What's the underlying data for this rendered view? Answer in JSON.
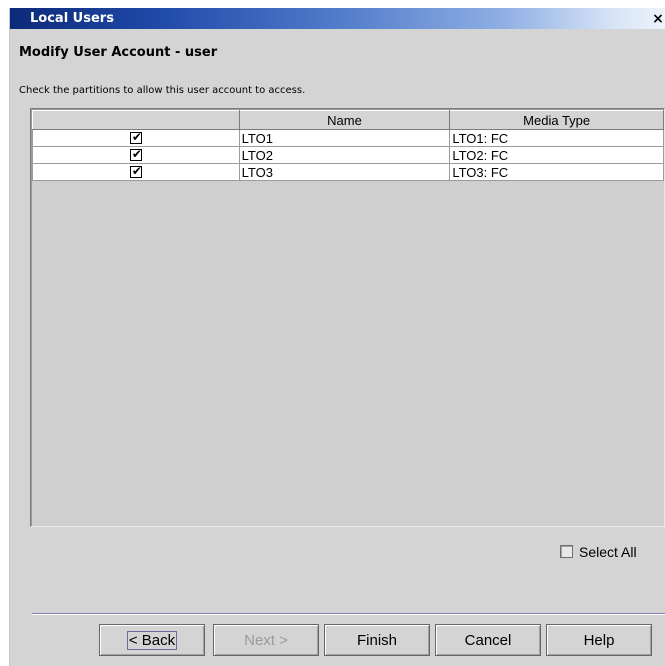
{
  "window": {
    "title": "Local Users",
    "close_glyph": "×"
  },
  "heading": "Modify User Account - user",
  "instruction": "Check the partitions to allow this user account to access.",
  "table": {
    "columns": [
      "",
      "Name",
      "Media Type"
    ],
    "rows": [
      {
        "checked": true,
        "name": "LTO1",
        "media_type": "LTO1: FC"
      },
      {
        "checked": true,
        "name": "LTO2",
        "media_type": "LTO2: FC"
      },
      {
        "checked": true,
        "name": "LTO3",
        "media_type": "LTO3: FC"
      }
    ]
  },
  "select_all": {
    "label": "Select All",
    "checked": false
  },
  "buttons": {
    "back": "< Back",
    "next": "Next >",
    "finish": "Finish",
    "cancel": "Cancel",
    "help": "Help"
  },
  "icons": {
    "checkmark": "checkmark-icon",
    "close": "close-icon"
  }
}
